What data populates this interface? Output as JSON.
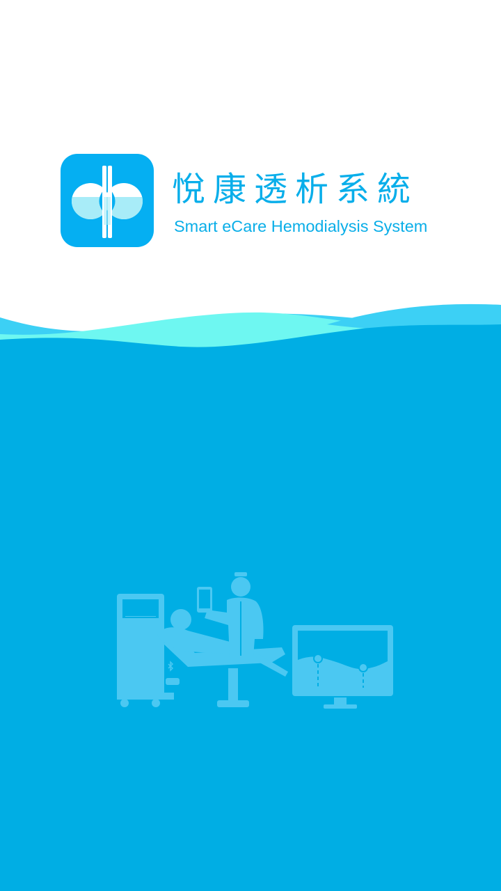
{
  "splash": {
    "app_name_cn": "悅康透析系統",
    "app_name_en": "Smart eCare Hemodialysis System",
    "logo_icon": "kidney-icon",
    "illustration_icon": "hemodialysis-scene-illustration"
  },
  "colors": {
    "brand_blue": "#00aee4",
    "logo_blue": "#05aff2",
    "wave_light_blue": "#3cd0f5",
    "wave_aqua": "#6ef7f1",
    "illustration_blue": "#4bc8f2",
    "background": "#ffffff"
  }
}
